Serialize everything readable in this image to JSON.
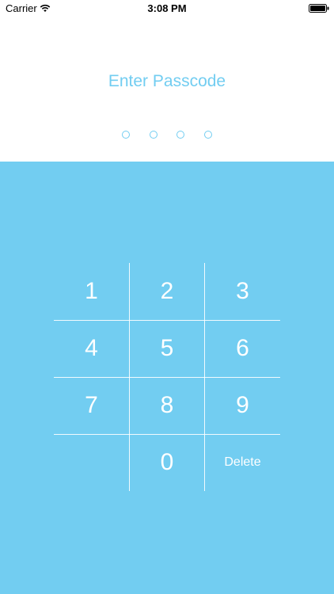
{
  "status_bar": {
    "carrier": "Carrier",
    "time": "3:08 PM",
    "wifi_icon": "wifi-icon",
    "battery_icon": "battery-icon"
  },
  "header": {
    "title": "Enter Passcode",
    "passcode_length": 4,
    "digits_entered": 0
  },
  "keypad": {
    "keys": [
      "1",
      "2",
      "3",
      "4",
      "5",
      "6",
      "7",
      "8",
      "9",
      "",
      "0",
      "Delete"
    ]
  },
  "colors": {
    "accent": "#72cdf1",
    "background": "#ffffff",
    "key_text": "#ffffff"
  }
}
